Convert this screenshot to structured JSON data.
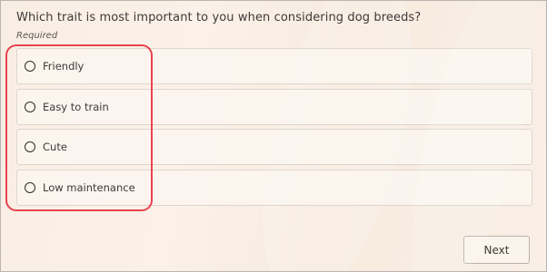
{
  "question": {
    "text": "Which trait is most important to you when considering dog breeds?",
    "required_label": "Required"
  },
  "options": [
    {
      "label": "Friendly"
    },
    {
      "label": "Easy to train"
    },
    {
      "label": "Cute"
    },
    {
      "label": "Low maintenance"
    }
  ],
  "actions": {
    "next_label": "Next"
  },
  "colors": {
    "highlight": "#e8434f",
    "background": "#f9eee4"
  }
}
